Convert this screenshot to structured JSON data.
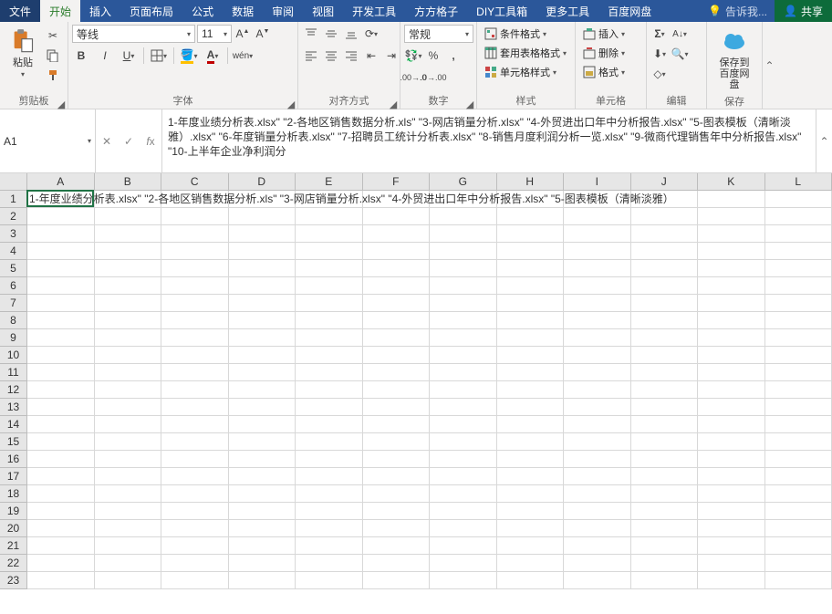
{
  "menu": {
    "file": "文件",
    "tabs": [
      "开始",
      "插入",
      "页面布局",
      "公式",
      "数据",
      "审阅",
      "视图",
      "开发工具",
      "方方格子",
      "DIY工具箱",
      "更多工具",
      "百度网盘"
    ],
    "active_index": 0,
    "tell_me": "告诉我...",
    "share": "共享"
  },
  "ribbon": {
    "clipboard": {
      "paste": "粘贴",
      "label": "剪贴板"
    },
    "font": {
      "name": "等线",
      "size": "11",
      "wen": "wén",
      "label": "字体"
    },
    "align": {
      "label": "对齐方式"
    },
    "number": {
      "format": "常规",
      "label": "数字"
    },
    "styles": {
      "cond": "条件格式",
      "table": "套用表格格式",
      "cell": "单元格样式",
      "label": "样式"
    },
    "cells": {
      "insert": "插入",
      "delete": "删除",
      "format": "格式",
      "label": "单元格"
    },
    "editing": {
      "label": "编辑"
    },
    "save": {
      "line1": "保存到",
      "line2": "百度网盘",
      "label": "保存"
    }
  },
  "name_box": "A1",
  "formula_text": "1-年度业绩分析表.xlsx\" \"2-各地区销售数据分析.xls\" \"3-网店销量分析.xlsx\" \"4-外贸进出口年中分析报告.xlsx\" \"5-图表模板（清晰淡雅）.xlsx\" \"6-年度销量分析表.xlsx\" \"7-招聘员工统计分析表.xlsx\" \"8-销售月度利润分析一览.xlsx\" \"9-微商代理销售年中分析报告.xlsx\" \"10-上半年企业净利润分",
  "columns": [
    "A",
    "B",
    "C",
    "D",
    "E",
    "F",
    "G",
    "H",
    "I",
    "J",
    "K",
    "L"
  ],
  "row_count": 23,
  "cell_a1": "1-年度业绩分析表.xlsx\" \"2-各地区销售数据分析.xls\" \"3-网店销量分析.xlsx\" \"4-外贸进出口年中分析报告.xlsx\" \"5-图表模板（清晰淡雅）"
}
